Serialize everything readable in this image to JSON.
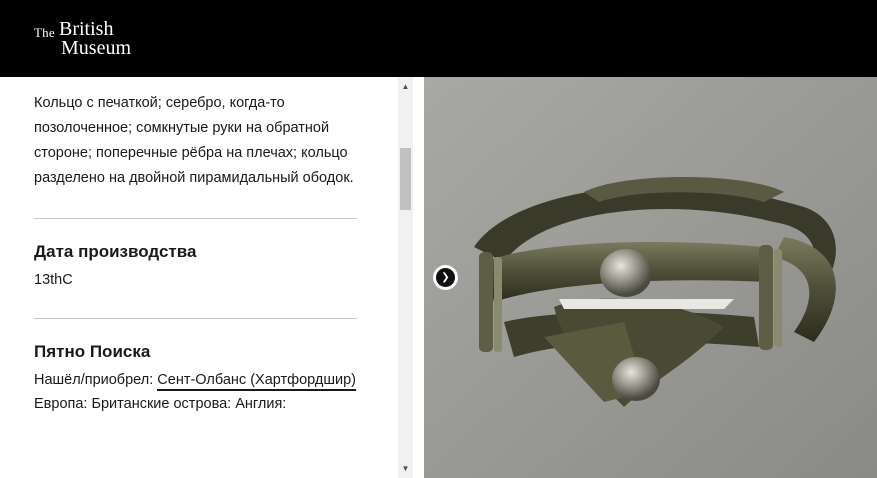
{
  "header": {
    "logo_the": "The",
    "logo_british": "British",
    "logo_museum": "Museum"
  },
  "details": {
    "description": "Кольцо с печаткой; серебро, когда-то позолоченное; сомкнутые руки на обратной стороне; поперечные рёбра на плечах; кольцо разделено на двойной пирамидальный ободок.",
    "production_date_title": "Дата производства",
    "production_date_value": "13thC",
    "findspot_title": "Пятно Поиска",
    "findspot_prefix": "Нашёл/приобрел: ",
    "findspot_link": "Сент-Олбанс (Хартфордшир)",
    "findspot_region": "Европа: Британские острова: Англия:"
  },
  "scrollbar": {
    "up_icon": "triangle-up",
    "down_icon": "triangle-down",
    "thumb_position_fraction": 0.18
  },
  "gallery": {
    "next_icon": "chevron-right"
  },
  "colors": {
    "header_bg": "#000000",
    "text": "#1a1a1a",
    "divider": "#c8c8c8"
  }
}
